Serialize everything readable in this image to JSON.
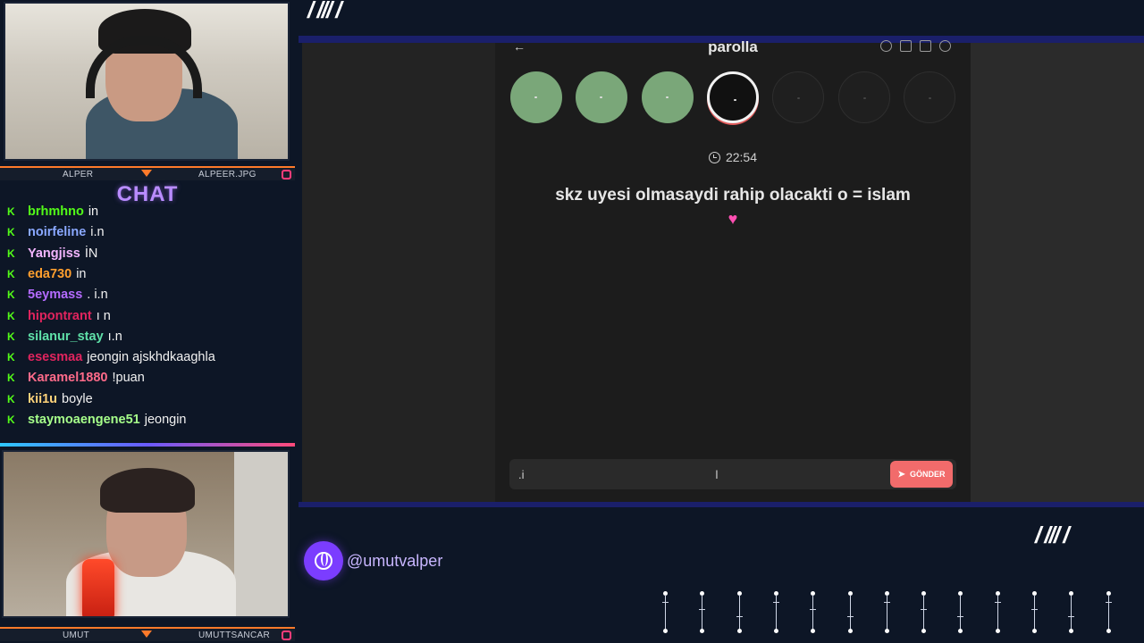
{
  "webcams": {
    "top": {
      "left_name": "ALPER",
      "right_name": "ALPEER.JPG"
    },
    "bottom": {
      "left_name": "UMUT",
      "right_name": "UMUTTSANCAR"
    }
  },
  "chat": {
    "title": "CHAT",
    "messages": [
      {
        "user": "brhmhno",
        "text": "in",
        "color": "#53fc18"
      },
      {
        "user": "noirfeline",
        "text": "i.n",
        "color": "#8aa8ff"
      },
      {
        "user": "Yangjiss",
        "text": "İN",
        "color": "#f4b6ff"
      },
      {
        "user": "eda730",
        "text": "in",
        "color": "#ff9f2e"
      },
      {
        "user": "5eymass",
        "text": ". i.n",
        "color": "#b46bff"
      },
      {
        "user": "hipontrant",
        "text": "ı n",
        "color": "#e0245e"
      },
      {
        "user": "silanur_stay",
        "text": "ı.n",
        "color": "#5fe0a8"
      },
      {
        "user": "esesmaa",
        "text": "jeongin ajskhdkaaghla",
        "color": "#e0245e"
      },
      {
        "user": "Karamel1880",
        "text": "!puan",
        "color": "#ff6b8a"
      },
      {
        "user": "kii1u",
        "text": "boyle",
        "color": "#ffd27a"
      },
      {
        "user": "staymoaengene51",
        "text": "jeongin",
        "color": "#a6ff8a"
      }
    ]
  },
  "app": {
    "title": "parolla",
    "timer": "22:54",
    "question": "skz uyesi olmasaydi rahip olacakti o = islam",
    "progress": [
      "done",
      "done",
      "done",
      "active",
      "pending",
      "pending",
      "pending"
    ],
    "answer_value": ".i",
    "send_label": "GÖNDER",
    "colors": {
      "done": "#7aa779",
      "send": "#f26b6b"
    }
  },
  "overlay": {
    "social_handle": "@umutvalper",
    "accent": "#7b3dff"
  }
}
